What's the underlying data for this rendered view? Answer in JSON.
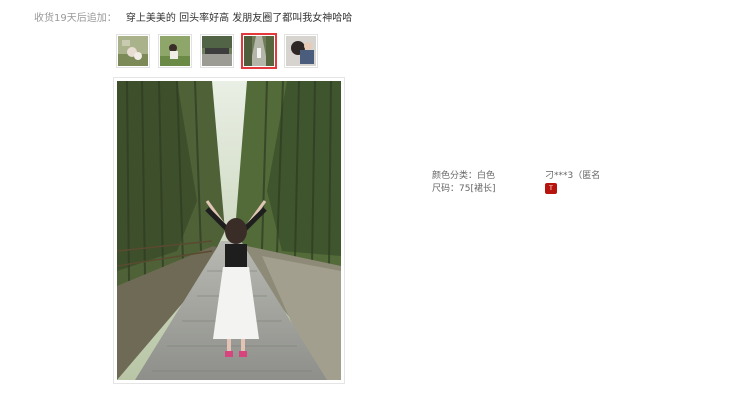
{
  "review": {
    "followup_label": "收货19天后追加：",
    "followup_text": "穿上美美的 回头率好高 发朋友圈了都叫我女神哈哈"
  },
  "thumbnails": [
    {
      "name": "thumbnail-1",
      "active": false
    },
    {
      "name": "thumbnail-2",
      "active": false
    },
    {
      "name": "thumbnail-3",
      "active": false
    },
    {
      "name": "thumbnail-4",
      "active": true
    },
    {
      "name": "thumbnail-5",
      "active": false
    }
  ],
  "sku": {
    "color_label": "颜色分类：",
    "color_value": "白色",
    "size_label": "尺码：",
    "size_value": "75[裙长]"
  },
  "reviewer": {
    "name": "刁***3（匿名",
    "level_badge_icon": "user-level-badge-icon"
  },
  "colors": {
    "accent": "#e4393c",
    "badge": "#b8140e"
  }
}
